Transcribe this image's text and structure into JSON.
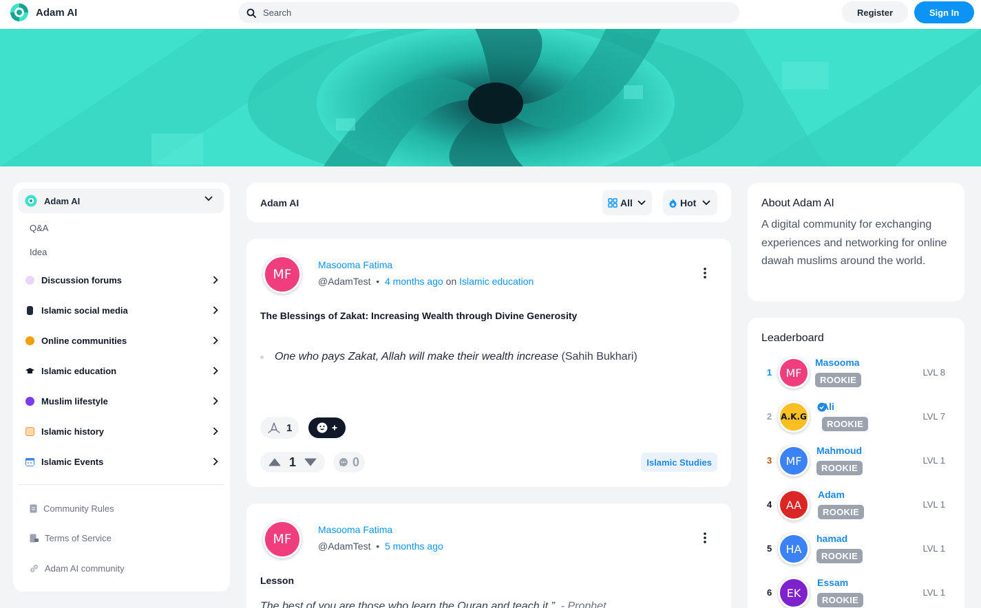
{
  "header": {
    "brand": "Adam AI",
    "search_placeholder": "Search",
    "register_label": "Register",
    "signin_label": "Sign In"
  },
  "sidebar": {
    "community": "Adam AI",
    "sub_items": [
      "Q&A",
      "Idea"
    ],
    "categories": [
      {
        "label": "Discussion forums",
        "icon": "speech-bubble-icon",
        "color": "#e9d5ff"
      },
      {
        "label": "Islamic social media",
        "icon": "phone-icon",
        "color": "#1f2937"
      },
      {
        "label": "Online communities",
        "icon": "handshake-icon",
        "color": "#f59e0b"
      },
      {
        "label": "Islamic education",
        "icon": "graduation-cap-icon",
        "color": "#111827"
      },
      {
        "label": "Muslim lifestyle",
        "icon": "people-icon",
        "color": "#7c3aed"
      },
      {
        "label": "Islamic history",
        "icon": "scroll-icon",
        "color": "#fb923c"
      },
      {
        "label": "Islamic Events",
        "icon": "calendar-icon",
        "color": "#3b82f6"
      }
    ],
    "footer_links": [
      {
        "label": "Community Rules",
        "icon": "document-icon"
      },
      {
        "label": "Terms of Service",
        "icon": "document-lock-icon"
      },
      {
        "label": "Adam AI community",
        "icon": "link-icon"
      }
    ]
  },
  "feed": {
    "title": "Adam AI",
    "filter_label": "All",
    "sort_label": "Hot"
  },
  "posts": [
    {
      "avatar": "MF",
      "author": "Masooma Fatima",
      "handle": "@AdamTest",
      "separator": "•",
      "time": "4 months ago",
      "on": "on",
      "category": "Islamic education",
      "title": "The Blessings of Zakat: Increasing Wealth through Divine Generosity",
      "quote": "One who pays Zakat, Allah will make their wealth increase",
      "source": "(Sahih Bukhari)",
      "reactions": "1",
      "votes": "1",
      "comments": "0",
      "tag": "Islamic Studies"
    },
    {
      "avatar": "MF",
      "author": "Masooma Fatima",
      "handle": "@AdamTest",
      "separator": "•",
      "time": "5 months ago",
      "title": "Lesson",
      "quote": "The best of you are those who learn the Quran and teach it.”",
      "source": "- Prophet"
    }
  ],
  "about": {
    "title": "About Adam AI",
    "text": "A digital community for exchanging experiences and networking for online dawah muslims around the world."
  },
  "leaderboard": {
    "title": "Leaderboard",
    "rows": [
      {
        "rank": "1",
        "initials": "MF",
        "name": "Masooma",
        "badge": "ROOKIE",
        "level": "LVL 8",
        "avatar_color": "#f03e7d",
        "rank_color": "#0b93f6"
      },
      {
        "rank": "2",
        "initials": "A.K.G",
        "name": "Ali",
        "badge": "ROOKIE",
        "level": "LVL 7",
        "avatar_color": "#fbbf24",
        "rank_color": "#9ca3af"
      },
      {
        "rank": "3",
        "initials": "MF",
        "name": "Mahmoud",
        "badge": "ROOKIE",
        "level": "LVL 1",
        "avatar_color": "#3b82f6",
        "rank_color": "#b45309"
      },
      {
        "rank": "4",
        "initials": "AA",
        "name": "Adam",
        "badge": "ROOKIE",
        "level": "LVL 1",
        "avatar_color": "#dc2626",
        "rank_color": "#111827"
      },
      {
        "rank": "5",
        "initials": "HA",
        "name": "hamad",
        "badge": "ROOKIE",
        "level": "LVL 1",
        "avatar_color": "#3b82f6",
        "rank_color": "#111827"
      },
      {
        "rank": "6",
        "initials": "EK",
        "name": "Essam",
        "badge": "ROOKIE",
        "level": "LVL 1",
        "avatar_color": "#7e22ce",
        "rank_color": "#111827"
      }
    ]
  },
  "colors": {
    "accent": "#0b93f6",
    "banner": "#3fe0cc"
  }
}
